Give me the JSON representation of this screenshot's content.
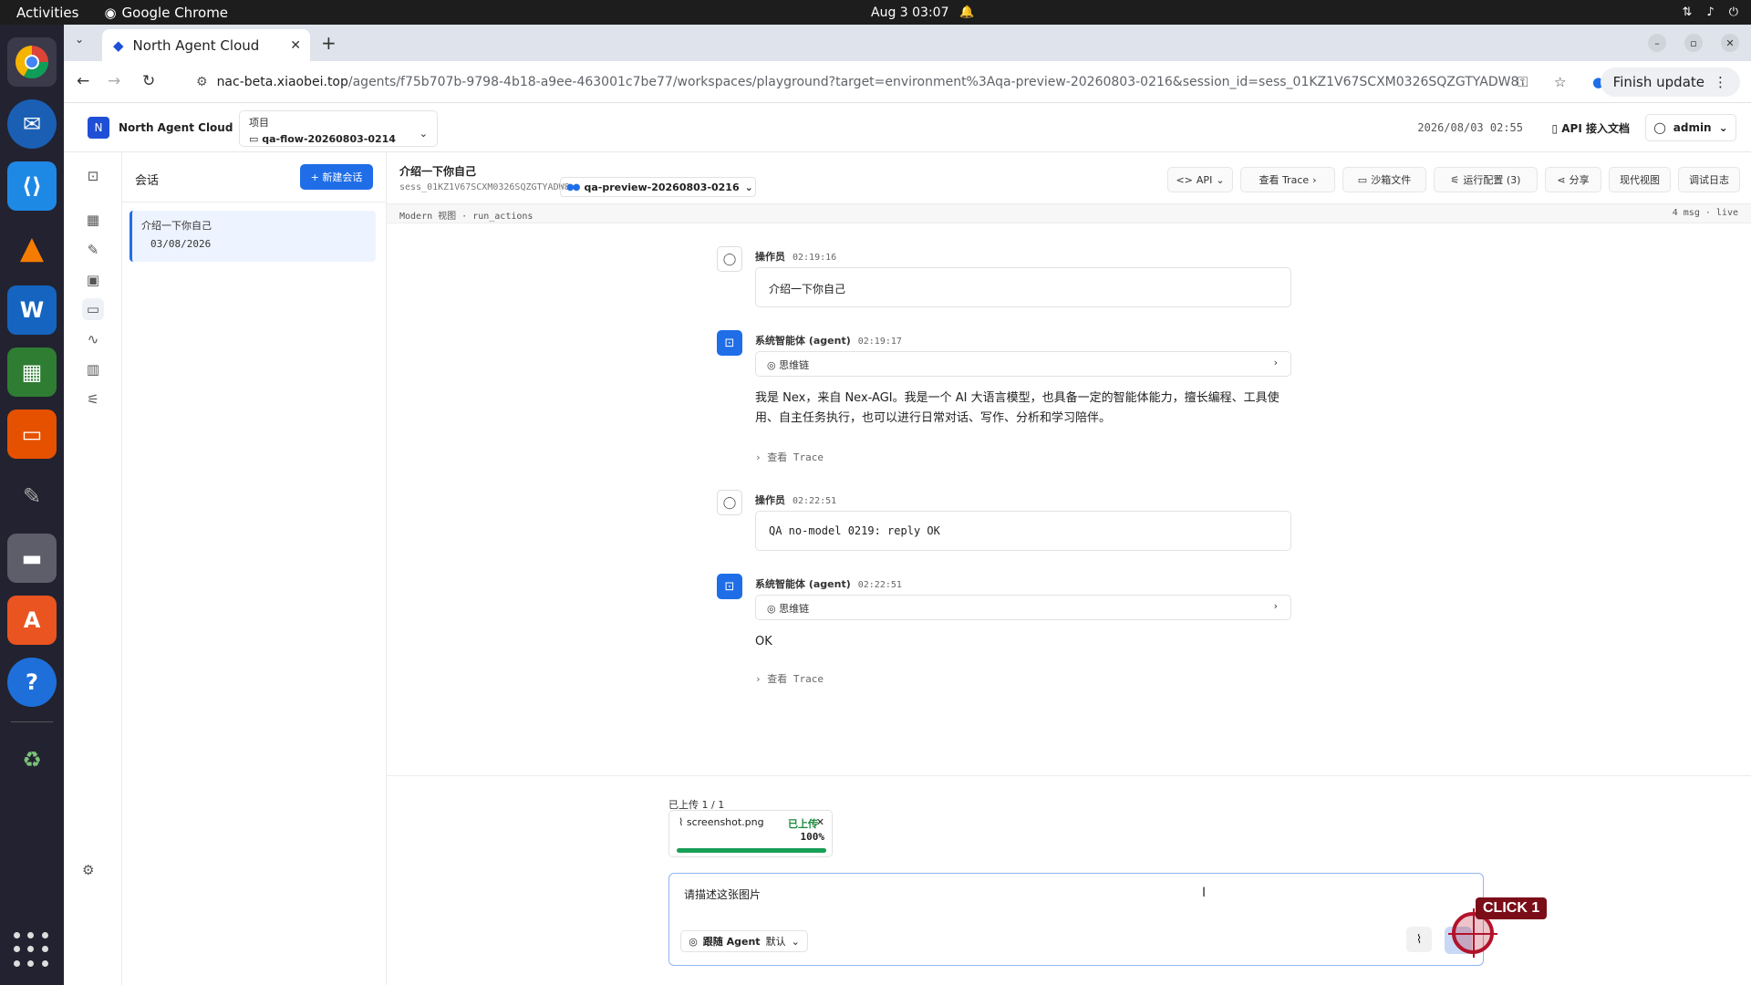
{
  "system": {
    "activities": "Activities",
    "app_name": "Google Chrome",
    "clock": "Aug 3  03:07"
  },
  "browser": {
    "tab_title": "North Agent Cloud",
    "url_host": "nac-beta.xiaobei.top",
    "url_path": "/agents/f75b707b-9798-4b18-a9ee-463001c7be77/workspaces/playground?target=environment%3Aqa-preview-20260803-0216&session_id=sess_01KZ1V67SCXM0326SQZGTYADW8",
    "finish_update": "Finish update"
  },
  "header": {
    "brand": "North Agent Cloud",
    "project_label": "项目",
    "project_value": "qa-flow-20260803-0214",
    "datetime": "2026/08/03 02:55",
    "api_doc": "API 接入文档",
    "user": "admin"
  },
  "sessions": {
    "title": "会话",
    "new_button": "+ 新建会话",
    "items": [
      {
        "title": "介绍一下你自己",
        "date": "03/08/2026"
      }
    ]
  },
  "main": {
    "session_title": "介绍一下你自己",
    "session_id": "sess_01KZ1V67SCXM0326SQZGTYADW8",
    "environment": "qa-preview-20260803-0216",
    "toolbar": {
      "api": "API",
      "trace": "查看 Trace",
      "sandbox": "沙箱文件",
      "run_config": "运行配置 (3)",
      "share": "分享",
      "modern_view": "现代视图",
      "debug_log": "调试日志"
    },
    "subbar_left": "Modern 视图 · run_actions",
    "subbar_right": "4 msg · live"
  },
  "messages": [
    {
      "role": "user",
      "author": "操作员",
      "time": "02:19:16",
      "text": "介绍一下你自己"
    },
    {
      "role": "agent",
      "author": "系统智能体 (agent)",
      "time": "02:19:17",
      "thinking": "思维链",
      "text": "我是 Nex，来自 Nex-AGI。我是一个 AI 大语言模型，也具备一定的智能体能力，擅长编程、工具使用、自主任务执行，也可以进行日常对话、写作、分析和学习陪伴。",
      "trace": "查看 Trace"
    },
    {
      "role": "user",
      "author": "操作员",
      "time": "02:22:51",
      "text": "QA no-model 0219: reply OK"
    },
    {
      "role": "agent",
      "author": "系统智能体 (agent)",
      "time": "02:22:51",
      "thinking": "思维链",
      "text": "OK",
      "trace": "查看 Trace"
    }
  ],
  "composer": {
    "upload_count": "已上传 1 / 1",
    "file_name": "screenshot.png",
    "file_status": "已上传",
    "file_progress": "100%",
    "file_progress_value": 1.0,
    "input_value": "请描述这张图片",
    "mode_label": "跟随 Agent",
    "mode_value": "默认"
  },
  "overlay": {
    "click_label": "CLICK 1"
  }
}
